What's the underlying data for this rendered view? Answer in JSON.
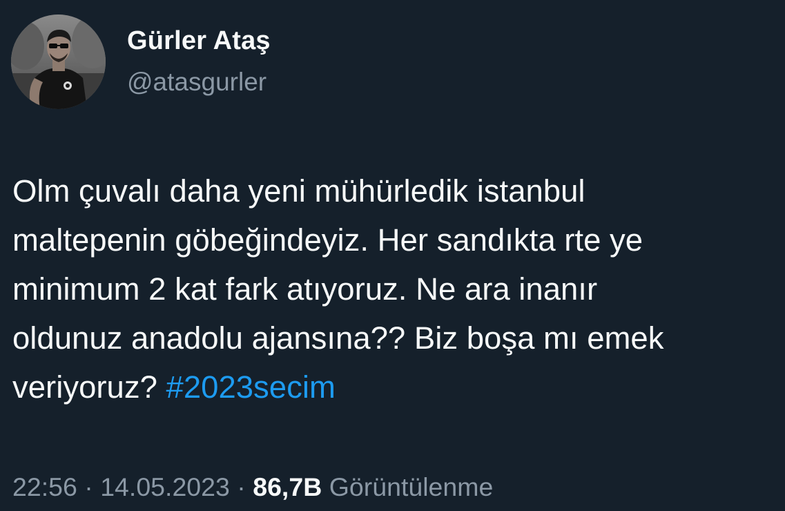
{
  "author": {
    "display_name": "Gürler Ataş",
    "handle": "@atasgurler"
  },
  "tweet": {
    "lines": [
      "Olm çuvalı daha yeni mühürledik istanbul",
      "maltepenin göbeğindeyiz. Her sandıkta rte ye",
      "minimum 2 kat fark atıyoruz. Ne ara inanır",
      "oldunuz anadolu ajansına?? Biz boşa mı emek"
    ],
    "last_line_text": "veriyoruz? ",
    "hashtag": "#2023secim",
    "hashtag_color": "#1d9bf0"
  },
  "meta": {
    "time": "22:56",
    "separator": "·",
    "date": "14.05.2023",
    "views_count": "86,7B",
    "views_label": "Görüntülenme"
  },
  "colors": {
    "background": "#15202b",
    "primary_text": "#f7f9f9",
    "secondary_text": "#8b98a5"
  }
}
